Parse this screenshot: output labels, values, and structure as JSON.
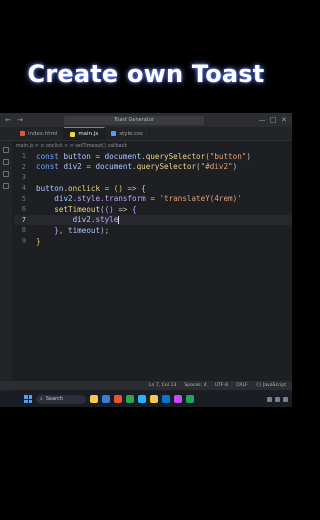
{
  "video": {
    "title": "Create own Toast"
  },
  "window": {
    "search_placeholder": "Toast Generator",
    "nav_back": "←",
    "nav_forward": "→",
    "window_controls": [
      "—",
      "□",
      "✕"
    ]
  },
  "tabs": [
    {
      "label": "index.html",
      "color": "#e4572e",
      "active": false
    },
    {
      "label": "main.js",
      "color": "#f1d24b",
      "active": true
    },
    {
      "label": "style.css",
      "color": "#4aa3ff",
      "active": false
    }
  ],
  "breadcrumb": "main.js > ⊙ onclick > ⊙ setTimeout() callback",
  "editor": {
    "lines": [
      {
        "n": "1",
        "tokens": [
          [
            "k",
            "const "
          ],
          [
            "v",
            "button"
          ],
          [
            "o",
            " = "
          ],
          [
            "v",
            "document"
          ],
          [
            "o",
            "."
          ],
          [
            "f",
            "querySelector"
          ],
          [
            "o",
            "("
          ],
          [
            "s",
            "\"button\""
          ],
          [
            "o",
            ")"
          ]
        ]
      },
      {
        "n": "2",
        "tokens": [
          [
            "k",
            "const "
          ],
          [
            "v",
            "div2"
          ],
          [
            "o",
            " = "
          ],
          [
            "v",
            "document"
          ],
          [
            "o",
            "."
          ],
          [
            "f",
            "querySelector"
          ],
          [
            "o",
            "("
          ],
          [
            "s",
            "\"#div2\""
          ],
          [
            "o",
            ")"
          ]
        ]
      },
      {
        "n": "3",
        "tokens": []
      },
      {
        "n": "4",
        "tokens": [
          [
            "v",
            "button"
          ],
          [
            "o",
            "."
          ],
          [
            "f",
            "onclick"
          ],
          [
            "o",
            " = "
          ],
          [
            "b",
            "()"
          ],
          [
            "o",
            " => "
          ],
          [
            "b",
            "{"
          ]
        ]
      },
      {
        "n": "5",
        "tokens": [
          [
            "o",
            "    "
          ],
          [
            "v",
            "div2"
          ],
          [
            "o",
            "."
          ],
          [
            "p",
            "style"
          ],
          [
            "o",
            "."
          ],
          [
            "p",
            "transform"
          ],
          [
            "o",
            " = "
          ],
          [
            "s",
            "'translateY(4rem)'"
          ]
        ]
      },
      {
        "n": "6",
        "tokens": [
          [
            "o",
            "    "
          ],
          [
            "f",
            "setTimeout"
          ],
          [
            "o",
            "("
          ],
          [
            "p",
            "()"
          ],
          [
            "o",
            " => "
          ],
          [
            "p",
            "{"
          ]
        ]
      },
      {
        "n": "7",
        "tokens": [
          [
            "o",
            "        "
          ],
          [
            "v",
            "div2"
          ],
          [
            "o",
            "."
          ],
          [
            "p",
            "style"
          ]
        ],
        "current": true
      },
      {
        "n": "8",
        "tokens": [
          [
            "o",
            "    "
          ],
          [
            "p",
            "}"
          ],
          [
            "o",
            ", "
          ],
          [
            "v",
            "timeout"
          ],
          [
            "o",
            ");"
          ]
        ]
      },
      {
        "n": "9",
        "tokens": [
          [
            "b",
            "}"
          ]
        ]
      }
    ]
  },
  "statusbar": {
    "position": "Ln 7, Col 13",
    "spaces": "Spaces: 4",
    "encoding": "UTF-8",
    "eol": "CRLF",
    "language": "{} JavaScript"
  },
  "taskbar": {
    "search_label": "Search",
    "apps": [
      "#f6c94a",
      "#3a7bd5",
      "#e8542c",
      "#2ea44f",
      "#1fb6ff",
      "#f6c94a",
      "#0078d4",
      "#c34cff",
      "#22a559"
    ]
  }
}
